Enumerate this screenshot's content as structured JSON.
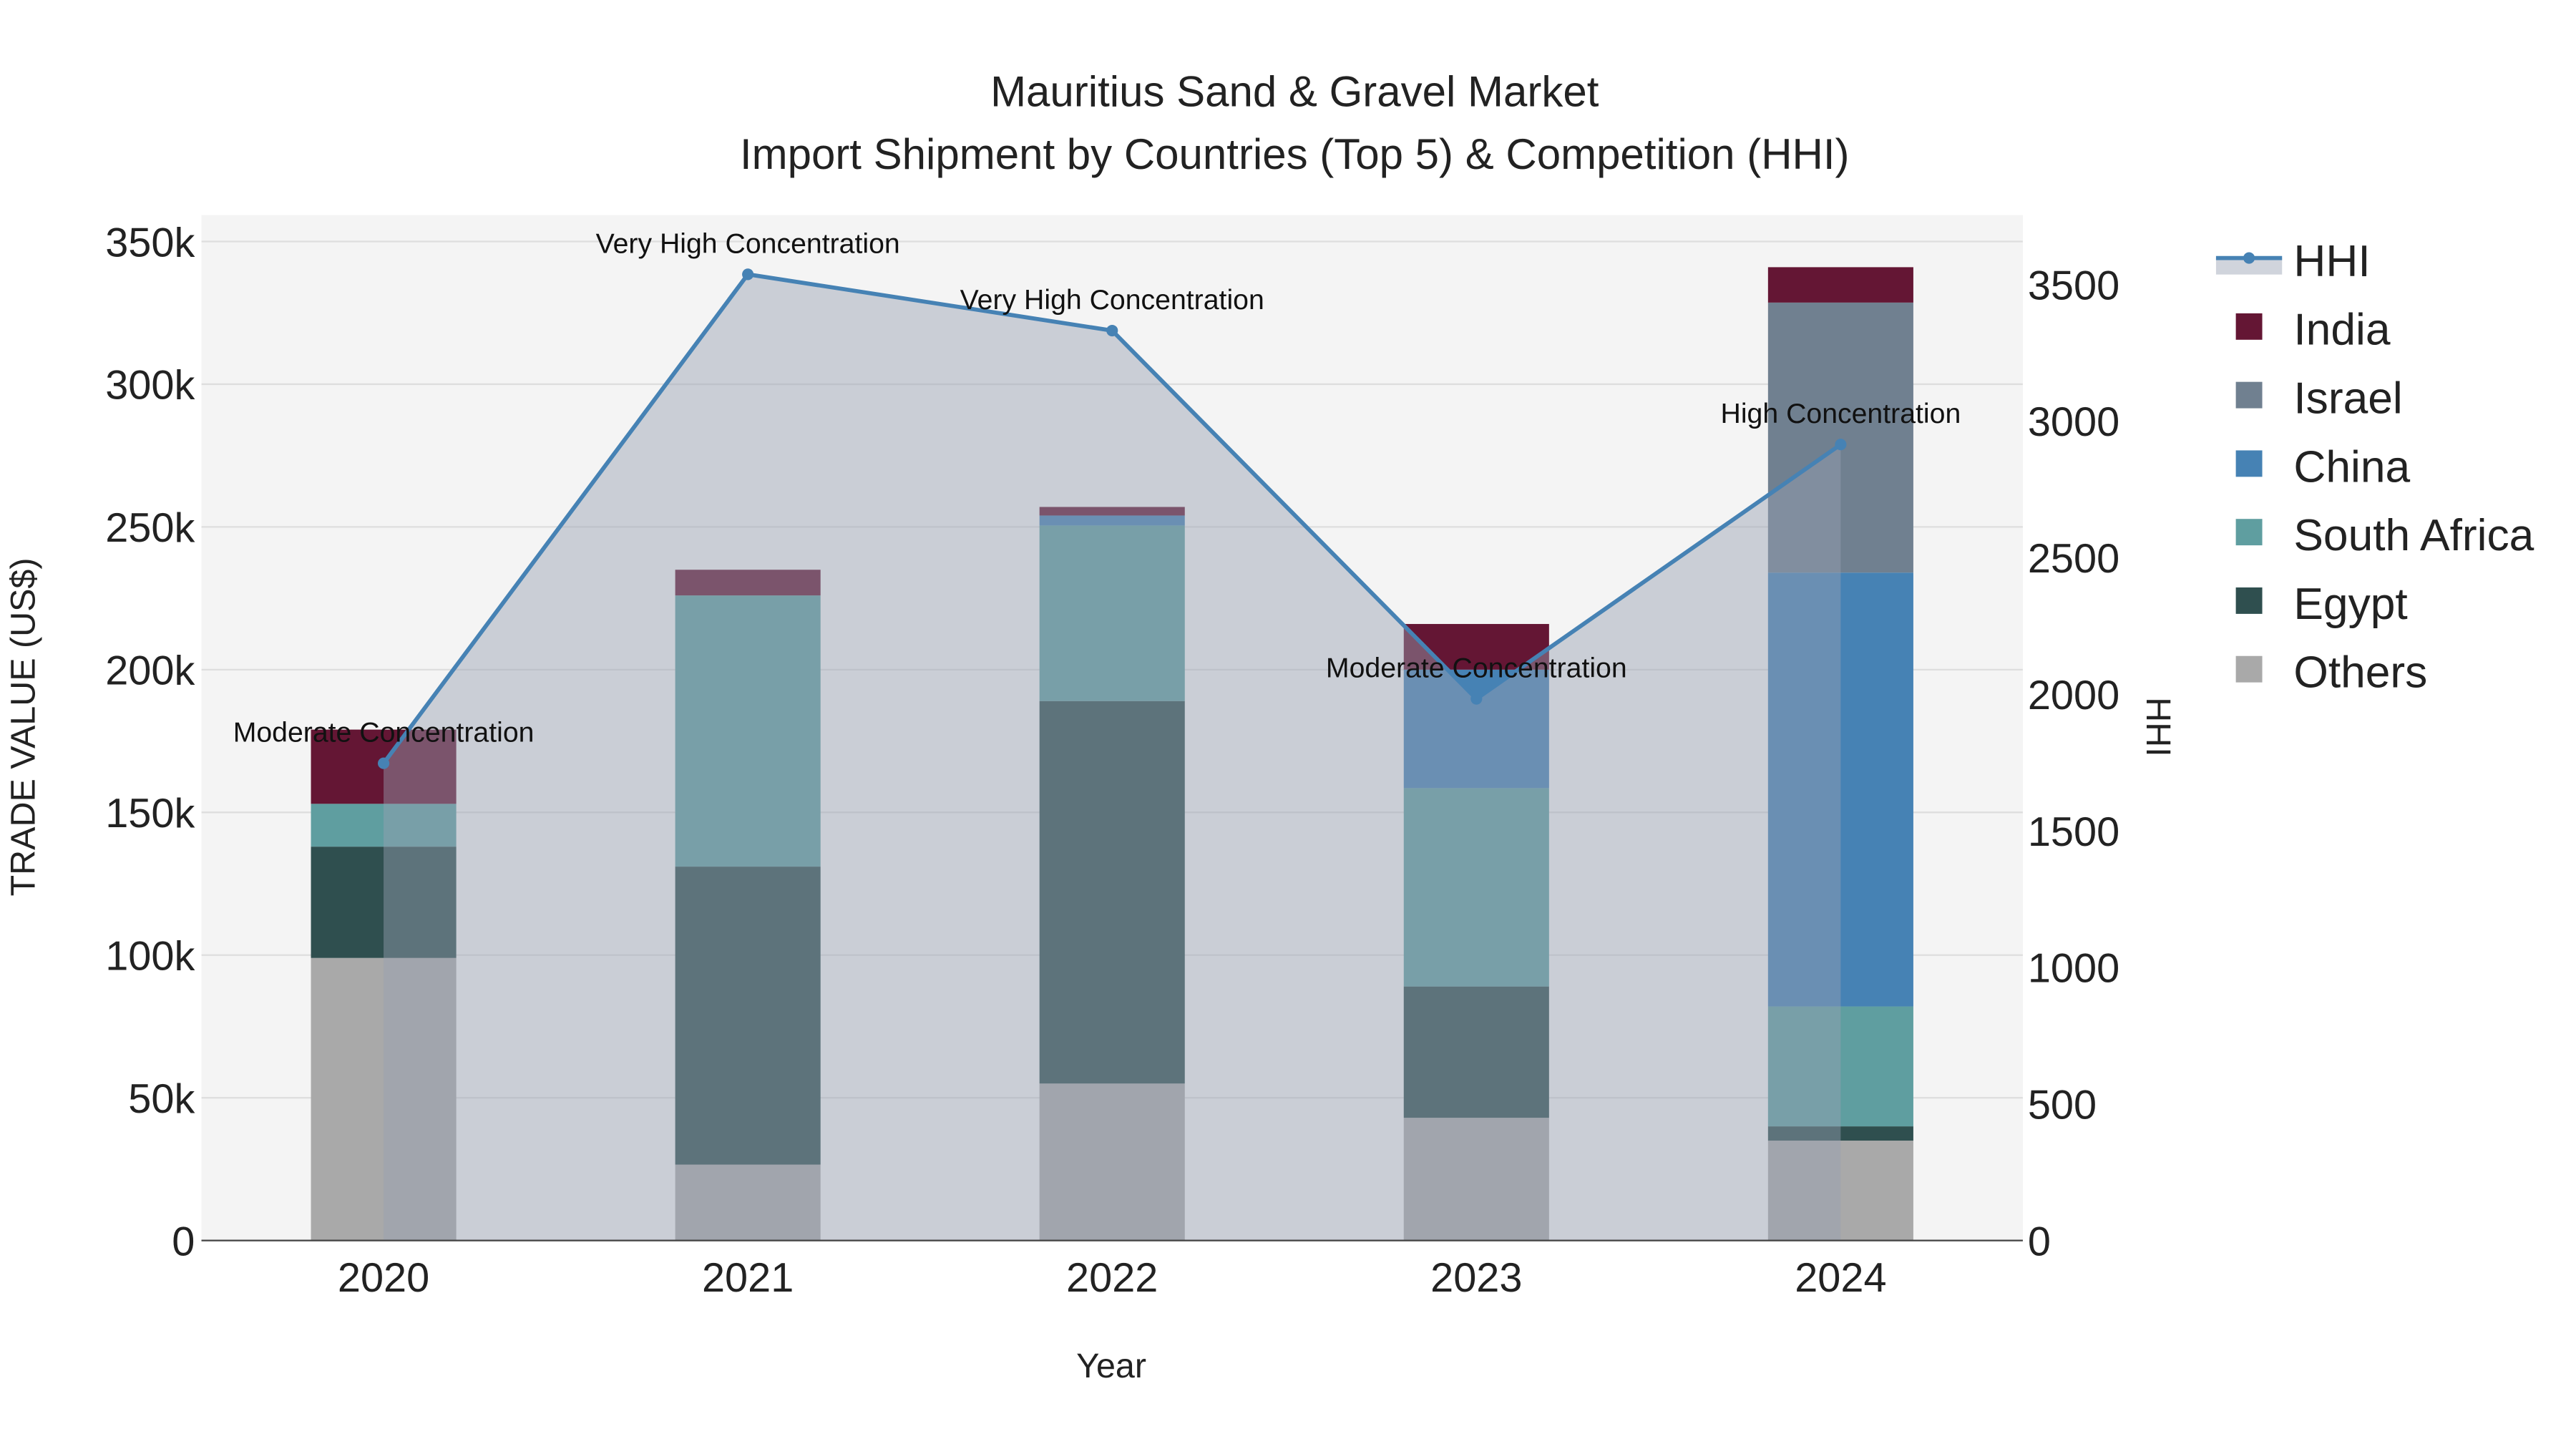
{
  "chart_data": {
    "type": "bar",
    "stacked": true,
    "title": "Mauritius Sand & Gravel Market",
    "subtitle": "Import Shipment by Countries (Top 5) & Competition (HHI)",
    "xlabel": "Year",
    "ylabel": "TRADE VALUE (US$)",
    "y2label": "HHI",
    "categories": [
      "2020",
      "2021",
      "2022",
      "2023",
      "2024"
    ],
    "ylim": [
      0,
      360000
    ],
    "y_ticks": [
      0,
      50000,
      100000,
      150000,
      200000,
      250000,
      300000,
      350000
    ],
    "y_tick_labels": [
      "0",
      "50k",
      "100k",
      "150k",
      "200k",
      "250k",
      "300k",
      "350k"
    ],
    "y2lim": [
      0,
      3760
    ],
    "y2_ticks": [
      0,
      500,
      1000,
      1500,
      2000,
      2500,
      3000,
      3500
    ],
    "y2_tick_labels": [
      "0",
      "500",
      "1000",
      "1500",
      "2000",
      "2500",
      "3000",
      "3500"
    ],
    "grid": true,
    "legend_position": "right",
    "series": [
      {
        "name": "Others",
        "color": "#A9A9A9",
        "values": [
          99000,
          26600,
          55000,
          43000,
          35000
        ]
      },
      {
        "name": "Egypt",
        "color": "#2F4F4F",
        "values": [
          39000,
          104400,
          134000,
          46000,
          5000
        ]
      },
      {
        "name": "South Africa",
        "color": "#5F9EA0",
        "values": [
          15000,
          95000,
          61500,
          69500,
          42000
        ]
      },
      {
        "name": "China",
        "color": "#4682B4",
        "values": [
          0,
          0,
          3500,
          41500,
          152000
        ]
      },
      {
        "name": "Israel",
        "color": "#708090",
        "values": [
          0,
          0,
          0,
          0,
          94600
        ]
      },
      {
        "name": "India",
        "color": "#641634",
        "values": [
          26000,
          9000,
          3000,
          16000,
          12400
        ]
      }
    ],
    "hhi": {
      "name": "HHI",
      "color": "#4682B4",
      "values": [
        1747,
        3537,
        3331,
        1983,
        2914
      ],
      "annotations": [
        "Moderate Concentration",
        "Very High Concentration",
        "Very High Concentration",
        "Moderate Concentration",
        "High Concentration"
      ]
    },
    "legend_order": [
      "HHI",
      "India",
      "Israel",
      "China",
      "South Africa",
      "Egypt",
      "Others"
    ]
  }
}
